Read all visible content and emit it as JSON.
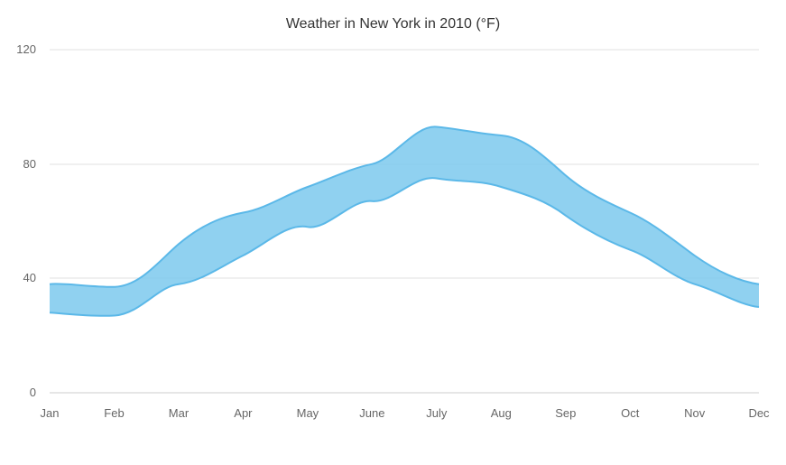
{
  "chart": {
    "title": "Weather in New York in 2010 (°F)",
    "x_labels": [
      "Jan",
      "Feb",
      "Mar",
      "Apr",
      "May",
      "June",
      "July",
      "Aug",
      "Sep",
      "Oct",
      "Nov",
      "Dec"
    ],
    "y_labels": [
      "0",
      "40",
      "80",
      "120"
    ],
    "area_color": "#7DC9ED",
    "area_fill_opacity": "0.85"
  }
}
